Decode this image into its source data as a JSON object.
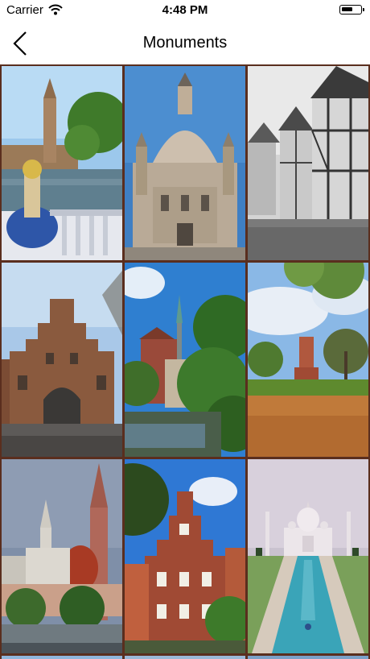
{
  "status_bar": {
    "carrier": "Carrier",
    "time": "4:48 PM"
  },
  "nav": {
    "title": "Monuments",
    "back_icon": "chevron-left-icon"
  },
  "gallery": {
    "items": [
      "plaza-spain-tower-photo",
      "dresden-frauenkirche-photo",
      "half-timbered-street-photo",
      "stepped-gable-gate-photo",
      "canal-church-spire-photo",
      "brick-tower-park-photo",
      "gothic-church-city-photo",
      "brick-gable-house-photo",
      "taj-mahal-photo"
    ]
  }
}
